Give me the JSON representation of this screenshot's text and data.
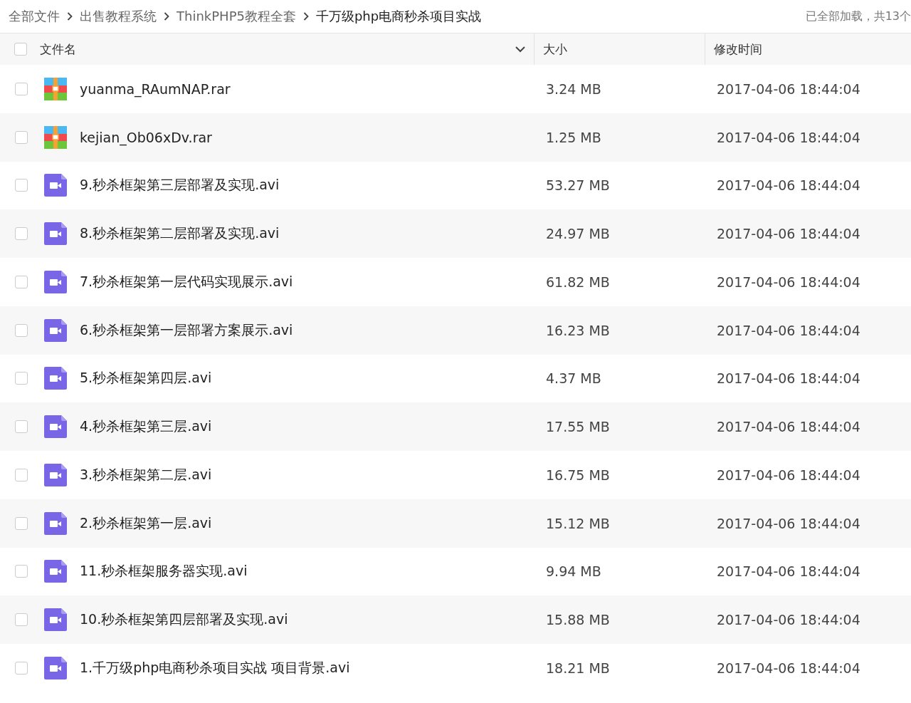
{
  "breadcrumb": [
    {
      "label": "全部文件",
      "current": false
    },
    {
      "label": "出售教程系统",
      "current": false
    },
    {
      "label": "ThinkPHP5教程全套",
      "current": false
    },
    {
      "label": "千万级php电商秒杀项目实战",
      "current": true
    }
  ],
  "status": "已全部加载，共13个",
  "header": {
    "checked": false,
    "columns": [
      "文件名",
      "大小",
      "修改时间"
    ]
  },
  "rows": [
    {
      "kind": "archive",
      "checked": false,
      "name": "yuanma_RAumNAP.rar",
      "size": "3.24 MB",
      "modified": "2017-04-06 18:44:04"
    },
    {
      "kind": "archive",
      "checked": false,
      "name": "kejian_Ob06xDv.rar",
      "size": "1.25 MB",
      "modified": "2017-04-06 18:44:04"
    },
    {
      "kind": "video",
      "checked": false,
      "name": "9.秒杀框架第三层部署及实现.avi",
      "size": "53.27 MB",
      "modified": "2017-04-06 18:44:04"
    },
    {
      "kind": "video",
      "checked": false,
      "name": "8.秒杀框架第二层部署及实现.avi",
      "size": "24.97 MB",
      "modified": "2017-04-06 18:44:04"
    },
    {
      "kind": "video",
      "checked": false,
      "name": "7.秒杀框架第一层代码实现展示.avi",
      "size": "61.82 MB",
      "modified": "2017-04-06 18:44:04"
    },
    {
      "kind": "video",
      "checked": false,
      "name": "6.秒杀框架第一层部署方案展示.avi",
      "size": "16.23 MB",
      "modified": "2017-04-06 18:44:04"
    },
    {
      "kind": "video",
      "checked": false,
      "name": "5.秒杀框架第四层.avi",
      "size": "4.37 MB",
      "modified": "2017-04-06 18:44:04"
    },
    {
      "kind": "video",
      "checked": false,
      "name": "4.秒杀框架第三层.avi",
      "size": "17.55 MB",
      "modified": "2017-04-06 18:44:04"
    },
    {
      "kind": "video",
      "checked": false,
      "name": "3.秒杀框架第二层.avi",
      "size": "16.75 MB",
      "modified": "2017-04-06 18:44:04"
    },
    {
      "kind": "video",
      "checked": false,
      "name": "2.秒杀框架第一层.avi",
      "size": "15.12 MB",
      "modified": "2017-04-06 18:44:04"
    },
    {
      "kind": "video",
      "checked": false,
      "name": "11.秒杀框架服务器实现.avi",
      "size": "9.94 MB",
      "modified": "2017-04-06 18:44:04"
    },
    {
      "kind": "video",
      "checked": false,
      "name": "10.秒杀框架第四层部署及实现.avi",
      "size": "15.88 MB",
      "modified": "2017-04-06 18:44:04"
    },
    {
      "kind": "video",
      "checked": false,
      "name": "1.千万级php电商秒杀项目实战 项目背景.avi",
      "size": "18.21 MB",
      "modified": "2017-04-06 18:44:04"
    }
  ]
}
